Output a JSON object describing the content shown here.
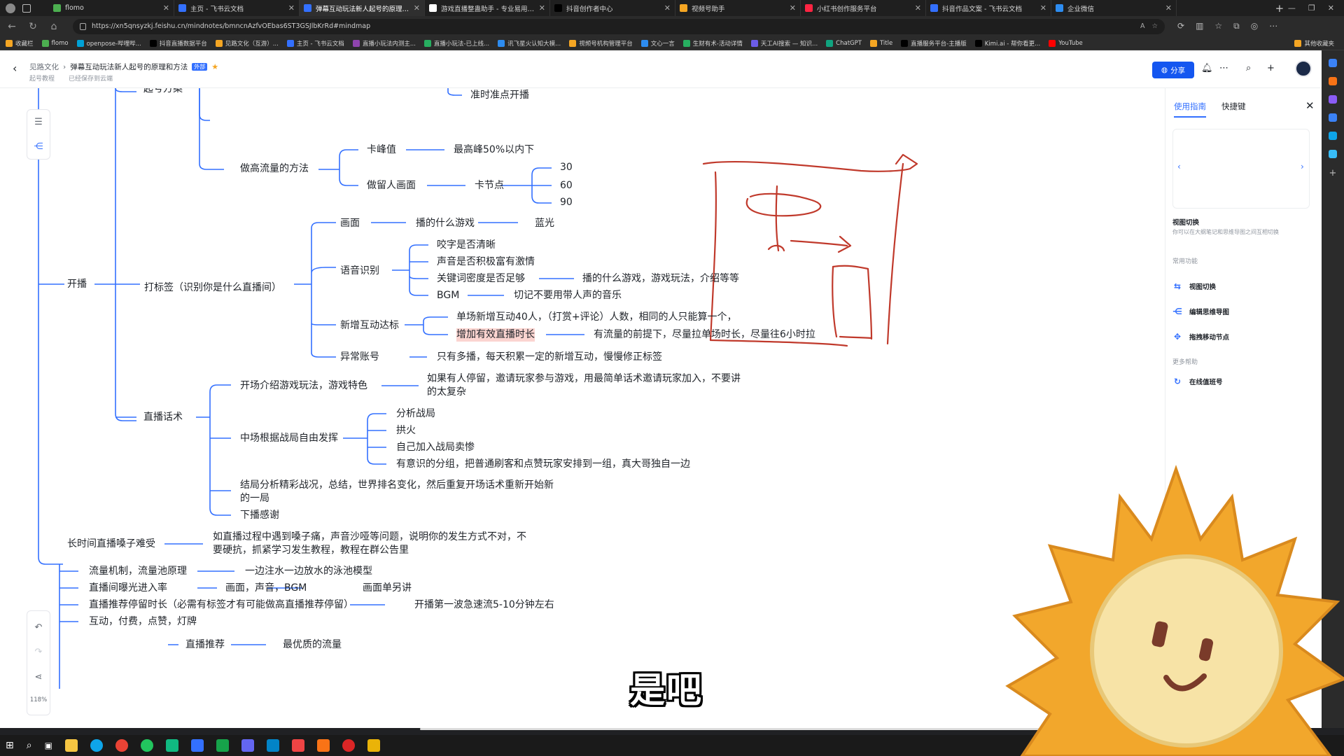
{
  "browser": {
    "tabs": [
      {
        "title": "flomo",
        "color": "#4caf50"
      },
      {
        "title": "主页 - 飞书云文档",
        "color": "#3370ff"
      },
      {
        "title": "弹幕互动玩法新人起号的原理和...",
        "color": "#3370ff"
      },
      {
        "title": "游戏直播整蛊助手 - 专业易用的C...",
        "color": "#ffffff"
      },
      {
        "title": "抖音创作者中心",
        "color": "#000000"
      },
      {
        "title": "视频号助手",
        "color": "#f5a623"
      },
      {
        "title": "小红书创作服务平台",
        "color": "#ff2442"
      },
      {
        "title": "抖音作品文案 - 飞书云文档",
        "color": "#3370ff"
      },
      {
        "title": "企业微信",
        "color": "#2d8cf0"
      }
    ],
    "url": "https://xn5qnsyzkj.feishu.cn/mindnotes/bmncnAzfvOEbas6ST3GSJlbKrRd#mindmap",
    "bookmarks": [
      {
        "label": "收藏栏",
        "color": "#f5a623"
      },
      {
        "label": "flomo",
        "color": "#4caf50"
      },
      {
        "label": "openpose-哔哩哔...",
        "color": "#00a1d6"
      },
      {
        "label": "抖音直播数据平台",
        "color": "#000000"
      },
      {
        "label": "见路文化（互游）...",
        "color": "#f5a623"
      },
      {
        "label": "主页 - 飞书云文档",
        "color": "#3370ff"
      },
      {
        "label": "直播小玩法内测主...",
        "color": "#8e44ad"
      },
      {
        "label": "直播小玩法-已上线...",
        "color": "#27ae60"
      },
      {
        "label": "讯飞星火认知大模...",
        "color": "#2d8cf0"
      },
      {
        "label": "视频号机构管理平台",
        "color": "#f5a623"
      },
      {
        "label": "文心一言",
        "color": "#2d8cf0"
      },
      {
        "label": "生财有术-活动详情",
        "color": "#27ae60"
      },
      {
        "label": "天工AI搜索 — 知识...",
        "color": "#6c5ce7"
      },
      {
        "label": "ChatGPT",
        "color": "#10a37f"
      },
      {
        "label": "Title",
        "color": "#f5a623"
      },
      {
        "label": "直播服务平台-主播版",
        "color": "#000000"
      },
      {
        "label": "Kimi.ai - 帮你看更...",
        "color": "#000000"
      },
      {
        "label": "YouTube",
        "color": "#ff0000"
      }
    ],
    "other_bookmarks": "其他收藏夹"
  },
  "header": {
    "crumb_root": "见路文化",
    "crumb_doc": "弹幕互动玩法新人起号的原理和方法",
    "crumb_tag": "外部",
    "sub_folder": "起号教程",
    "saved": "已经保存到云端",
    "share": "分享"
  },
  "zoom": "118%",
  "mindmap": {
    "top_cut": "起号方案",
    "n_zhunshi": "准时准点开播",
    "n_zuogao": "做高流量的方法",
    "n_kafengzhi": "卡峰值",
    "n_kafengzhi_v": "最高峰50%以内下",
    "n_liuren": "做留人画面",
    "n_kajiedian": "卡节点",
    "n_30": "30",
    "n_60": "60",
    "n_90": "90",
    "n_kaibo": "开播",
    "n_dabiaoqian": "打标签（识别你是什么直播间）",
    "n_huamian": "画面",
    "n_bo_shenme": "播的什么游戏",
    "n_languang": "蓝光",
    "n_yuyin": "语音识别",
    "n_yaozi": "咬字是否清晰",
    "n_shengyin": "声音是否积极富有激情",
    "n_guanjianci": "关键词密度是否足够",
    "n_guanjianci_v": "播的什么游戏，游戏玩法，介绍等等",
    "n_bgm": "BGM",
    "n_bgm_v": "切记不要用带人声的音乐",
    "n_xinzeng": "新增互动达标",
    "n_danchang": "单场新增互动40人，（打赏+评论）人数，相同的人只能算一个，",
    "n_zengjia": "增加有效直播时长",
    "n_zengjia_v": "有流量的前提下，尽量拉单场时长，尽量往6小时拉",
    "n_yichang": "异常账号",
    "n_yichang_v": "只有多播，每天积累一定的新增互动，慢慢修正标签",
    "n_huashu": "直播话术",
    "n_kaichang": "开场介绍游戏玩法，游戏特色",
    "n_kaichang_v": "如果有人停留，邀请玩家参与游戏，用最简单话术邀请玩家加入，不要讲的太复杂",
    "n_zhongchang": "中场根据战局自由发挥",
    "n_fenxi": "分析战局",
    "n_gonghuo": "拱火",
    "n_ziji": "自己加入战局卖惨",
    "n_fenzu": "有意识的分组，把普通刷客和点赞玩家安排到一组，真大哥独自一边",
    "n_jieju": "结局分析精彩战况，总结，世界排名变化，然后重复开场话术重新开始新的一局",
    "n_xiabo": "下播感谢",
    "n_changshijian": "长时间直播嗓子难受",
    "n_changshijian_v": "如直播过程中遇到嗓子痛，声音沙哑等问题，说明你的发生方式不对，不要硬抗，抓紧学习发生教程，教程在群公告里",
    "n_liuliang": "流量机制，流量池原理",
    "n_liuliang_v": "一边注水一边放水的泳池模型",
    "n_baoguang": "直播间曝光进入率",
    "n_baoguang_v": "画面，声音，BGM",
    "n_baoguang_v2": "画面单另讲",
    "n_tuijian": "直播推荐停留时长（必需有标签才有可能做高直播推荐停留）",
    "n_tuijian_v": "开播第一波急速流5-10分钟左右",
    "n_hudong": "互动，付费，点赞，灯牌",
    "n_zbtj": "直播推荐",
    "n_zbtj_v": "最优质的流量"
  },
  "subtitle": "是吧",
  "guide": {
    "tab_guide": "使用指南",
    "tab_shortcut": "快捷键",
    "title": "视图切换",
    "desc": "你可以在大纲笔记和思维导图之间互相切换",
    "sec_common": "常用功能",
    "items": [
      "视图切换",
      "编辑思维导图",
      "拖拽移动节点"
    ],
    "sec_more": "更多帮助",
    "help": "在线值班号"
  },
  "colors": {
    "accent": "#3370ff",
    "share_bg": "#1456f0",
    "pen": "#c0392b",
    "highlight": "#fbd4d0",
    "connector": "#3370ff"
  }
}
